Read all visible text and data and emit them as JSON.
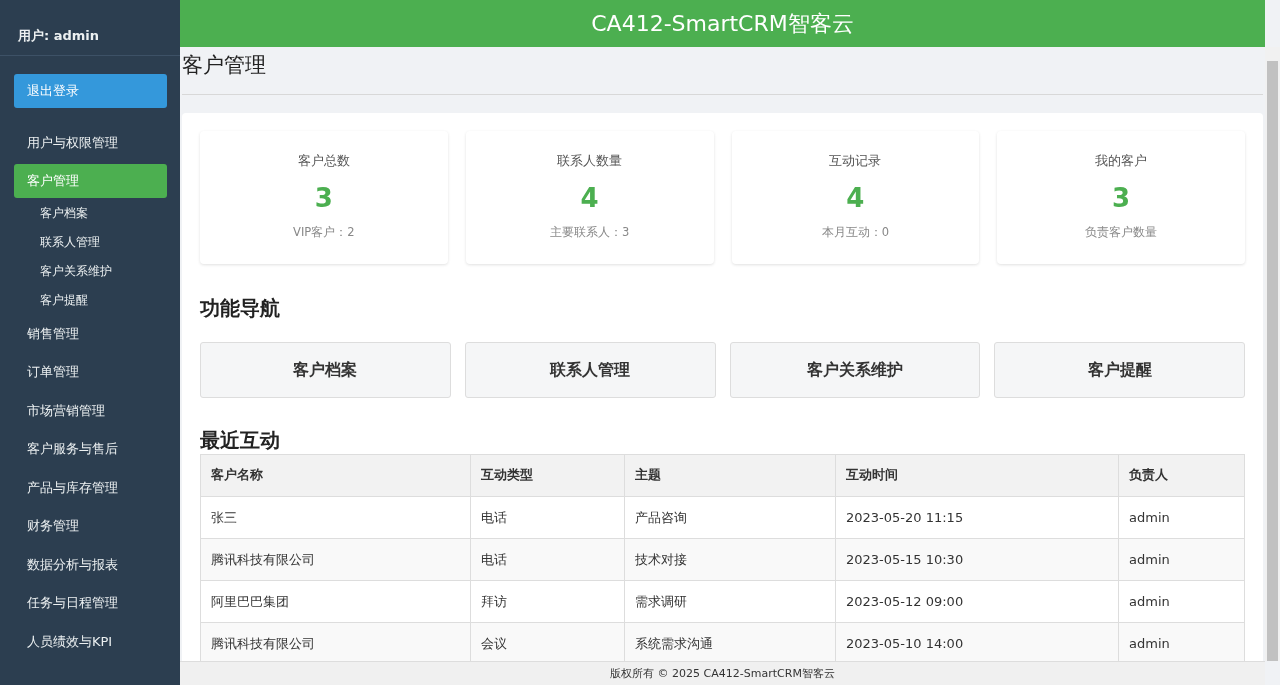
{
  "sidebar": {
    "user": "用户: admin",
    "logout": "退出登录",
    "items": [
      {
        "label": "用户与权限管理",
        "selected": false
      },
      {
        "label": "客户管理",
        "selected": true,
        "children": [
          {
            "label": "客户档案"
          },
          {
            "label": "联系人管理"
          },
          {
            "label": "客户关系维护"
          },
          {
            "label": "客户提醒"
          }
        ]
      },
      {
        "label": "销售管理",
        "selected": false
      },
      {
        "label": "订单管理",
        "selected": false
      },
      {
        "label": "市场营销管理",
        "selected": false
      },
      {
        "label": "客户服务与售后",
        "selected": false
      },
      {
        "label": "产品与库存管理",
        "selected": false
      },
      {
        "label": "财务管理",
        "selected": false
      },
      {
        "label": "数据分析与报表",
        "selected": false
      },
      {
        "label": "任务与日程管理",
        "selected": false
      },
      {
        "label": "人员绩效与KPI",
        "selected": false
      }
    ]
  },
  "header": {
    "title": "CA412-SmartCRM智客云"
  },
  "page_title": "客户管理",
  "stats": [
    {
      "label": "客户总数",
      "value": "3",
      "note": "VIP客户：2"
    },
    {
      "label": "联系人数量",
      "value": "4",
      "note": "主要联系人：3"
    },
    {
      "label": "互动记录",
      "value": "4",
      "note": "本月互动：0"
    },
    {
      "label": "我的客户",
      "value": "3",
      "note": "负责客户数量"
    }
  ],
  "nav_heading": "功能导航",
  "nav_buttons": [
    "客户档案",
    "联系人管理",
    "客户关系维护",
    "客户提醒"
  ],
  "recent_heading": "最近互动",
  "table": {
    "columns": [
      "客户名称",
      "互动类型",
      "主题",
      "互动时间",
      "负责人"
    ],
    "rows": [
      [
        "张三",
        "电话",
        "产品咨询",
        "2023-05-20 11:15",
        "admin"
      ],
      [
        "腾讯科技有限公司",
        "电话",
        "技术对接",
        "2023-05-15 10:30",
        "admin"
      ],
      [
        "阿里巴巴集团",
        "拜访",
        "需求调研",
        "2023-05-12 09:00",
        "admin"
      ],
      [
        "腾讯科技有限公司",
        "会议",
        "系统需求沟通",
        "2023-05-10 14:00",
        "admin"
      ]
    ]
  },
  "footer": "版权所有 © 2025 CA412-SmartCRM智客云"
}
